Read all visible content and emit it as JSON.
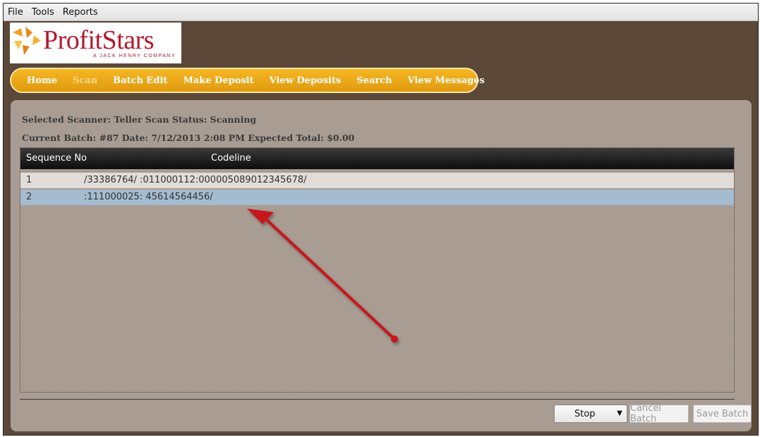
{
  "menu": {
    "items": [
      {
        "label": "File"
      },
      {
        "label": "Tools"
      },
      {
        "label": "Reports"
      }
    ]
  },
  "logo": {
    "text": "ProfitStars",
    "tagline": "A JACK HENRY COMPANY"
  },
  "nav": {
    "items": [
      {
        "label": "Home"
      },
      {
        "label": "Scan"
      },
      {
        "label": "Batch Edit"
      },
      {
        "label": "Make Deposit"
      },
      {
        "label": "View Deposits"
      },
      {
        "label": "Search"
      },
      {
        "label": "View Messages"
      }
    ],
    "active": "Scan"
  },
  "status": {
    "scanner_line": "Selected Scanner: Teller Scan  Status: Scanning",
    "batch_line": "Current Batch: #87 Date: 7/12/2013 2:08 PM Expected Total: $0.00"
  },
  "grid": {
    "columns": [
      "Sequence No",
      "Codeline"
    ],
    "rows": [
      {
        "seq": "1",
        "codeline": "/33386764/ :011000112:000005089012345678/"
      },
      {
        "seq": "2",
        "codeline": ":111000025: 45614564456/"
      }
    ]
  },
  "buttons": {
    "stop": "Stop",
    "cancel": "Cancel Batch",
    "save": "Save Batch"
  },
  "colors": {
    "window_bg": "#5c4838",
    "panel_bg": "#a89c93",
    "nav_bg": "#e8a416",
    "selected_row": "#a4bcd0",
    "annotation_arrow": "#c8161d"
  },
  "icons": {
    "logo": "profitstars-star-icon",
    "dropdown": "chevron-down-icon",
    "annotation": "red-arrow-annotation"
  }
}
